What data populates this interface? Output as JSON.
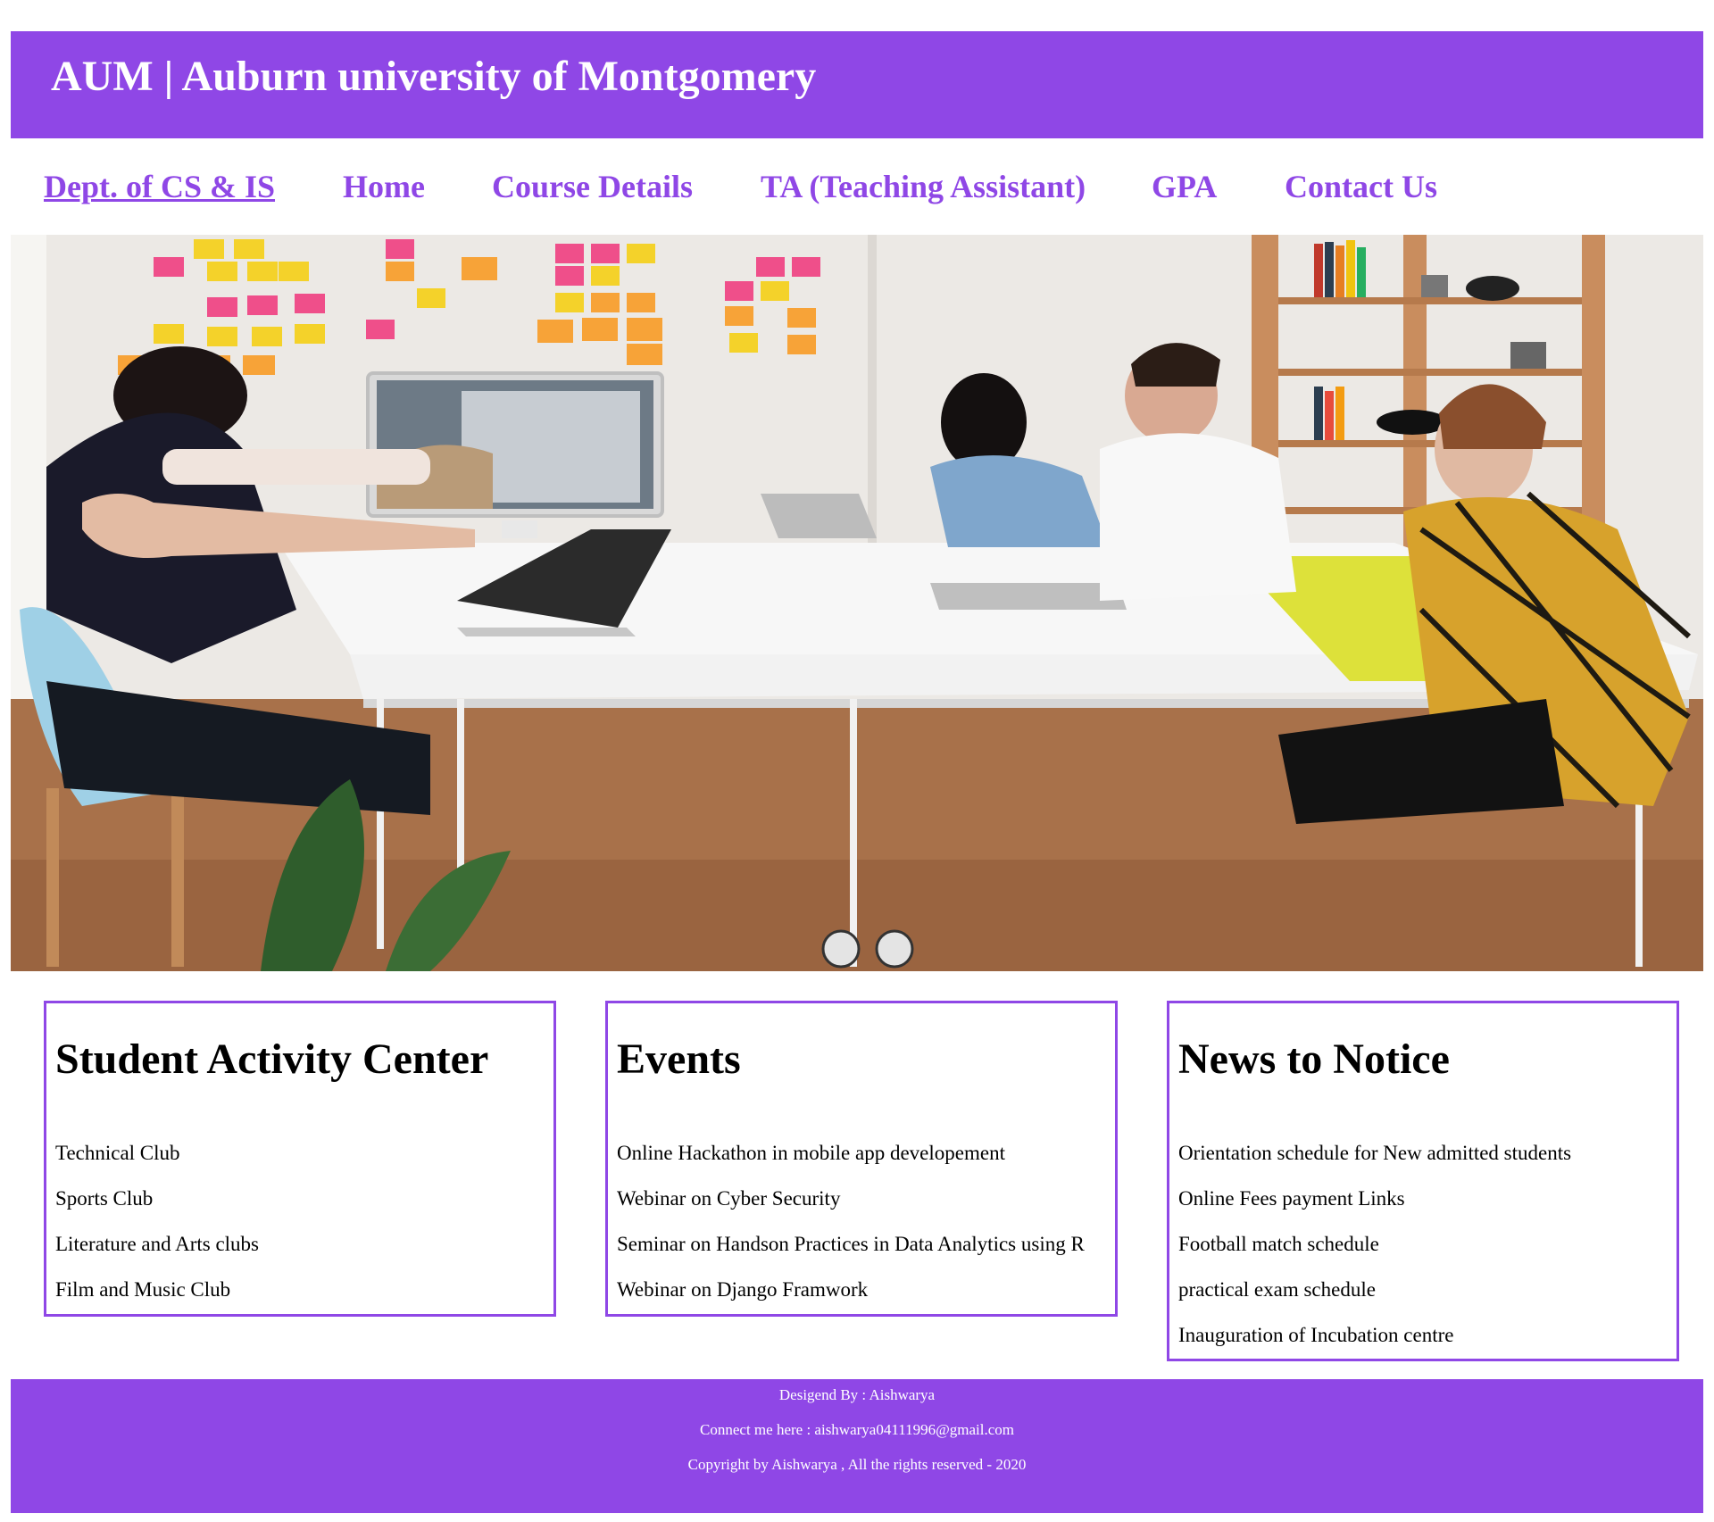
{
  "header": {
    "title": "AUM | Auburn university of Montgomery"
  },
  "nav": {
    "brand": "Dept. of CS & IS",
    "items": [
      "Home",
      "Course Details",
      "TA (Teaching Assistant)",
      "GPA",
      "Contact Us"
    ]
  },
  "hero": {
    "image_name": "team-meeting-photo"
  },
  "sections": [
    {
      "title": "Student Activity Center",
      "items": [
        "Technical Club",
        "Sports Club",
        "Literature and Arts clubs",
        "Film and Music Club"
      ]
    },
    {
      "title": "Events",
      "items": [
        "Online Hackathon in mobile app developement",
        "Webinar on Cyber Security",
        "Seminar on Handson Practices in Data Analytics using R",
        "Webinar on Django Framwork"
      ]
    },
    {
      "title": "News to Notice",
      "items": [
        "Orientation schedule for New admitted students",
        "Online Fees payment Links",
        "Football match schedule",
        "practical exam schedule",
        "Inauguration of Incubation centre"
      ]
    }
  ],
  "footer": {
    "designed_by": "Desigend By : Aishwarya",
    "connect": "Connect me here : aishwarya04111996@gmail.com",
    "copyright": "Copyright by Aishwarya , All the rights reserved - 2020"
  },
  "colors": {
    "accent": "#8f47e6",
    "text": "#000000",
    "background": "#ffffff"
  }
}
